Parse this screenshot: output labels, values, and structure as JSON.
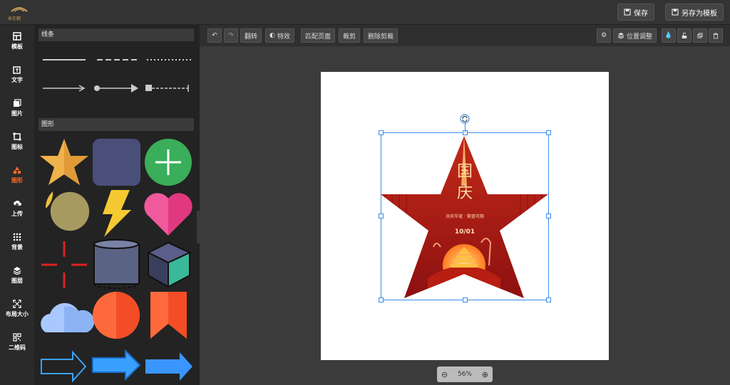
{
  "topbar": {
    "logo_text": "永在朝",
    "save_label": "保存",
    "save_as_template_label": "另存为模板"
  },
  "nav": {
    "items": [
      {
        "label": "模板",
        "icon": "template-icon"
      },
      {
        "label": "文字",
        "icon": "text-icon"
      },
      {
        "label": "图片",
        "icon": "image-icon"
      },
      {
        "label": "图标",
        "icon": "icon-set-icon"
      },
      {
        "label": "图形",
        "icon": "shapes-icon",
        "active": true
      },
      {
        "label": "上传",
        "icon": "upload-icon"
      },
      {
        "label": "背景",
        "icon": "background-icon"
      },
      {
        "label": "图层",
        "icon": "layers-icon"
      },
      {
        "label": "布局大小",
        "icon": "resize-icon"
      },
      {
        "label": "二维码",
        "icon": "qrcode-icon"
      }
    ],
    "active_color": "#ff6b2b"
  },
  "panel": {
    "lines_title": "线条",
    "shapes_title": "图形"
  },
  "toolbar": {
    "flip_label": "翻转",
    "effects_label": "特效",
    "fit_page_label": "匹配页面",
    "crop_label": "裁剪",
    "remove_crop_label": "删除剪裁",
    "position_label": "位置调整"
  },
  "design": {
    "title": "国庆",
    "subtitle": "共庆华诞 · 繁盛可期",
    "date": "10/01"
  },
  "zoom": {
    "level": "56%"
  }
}
